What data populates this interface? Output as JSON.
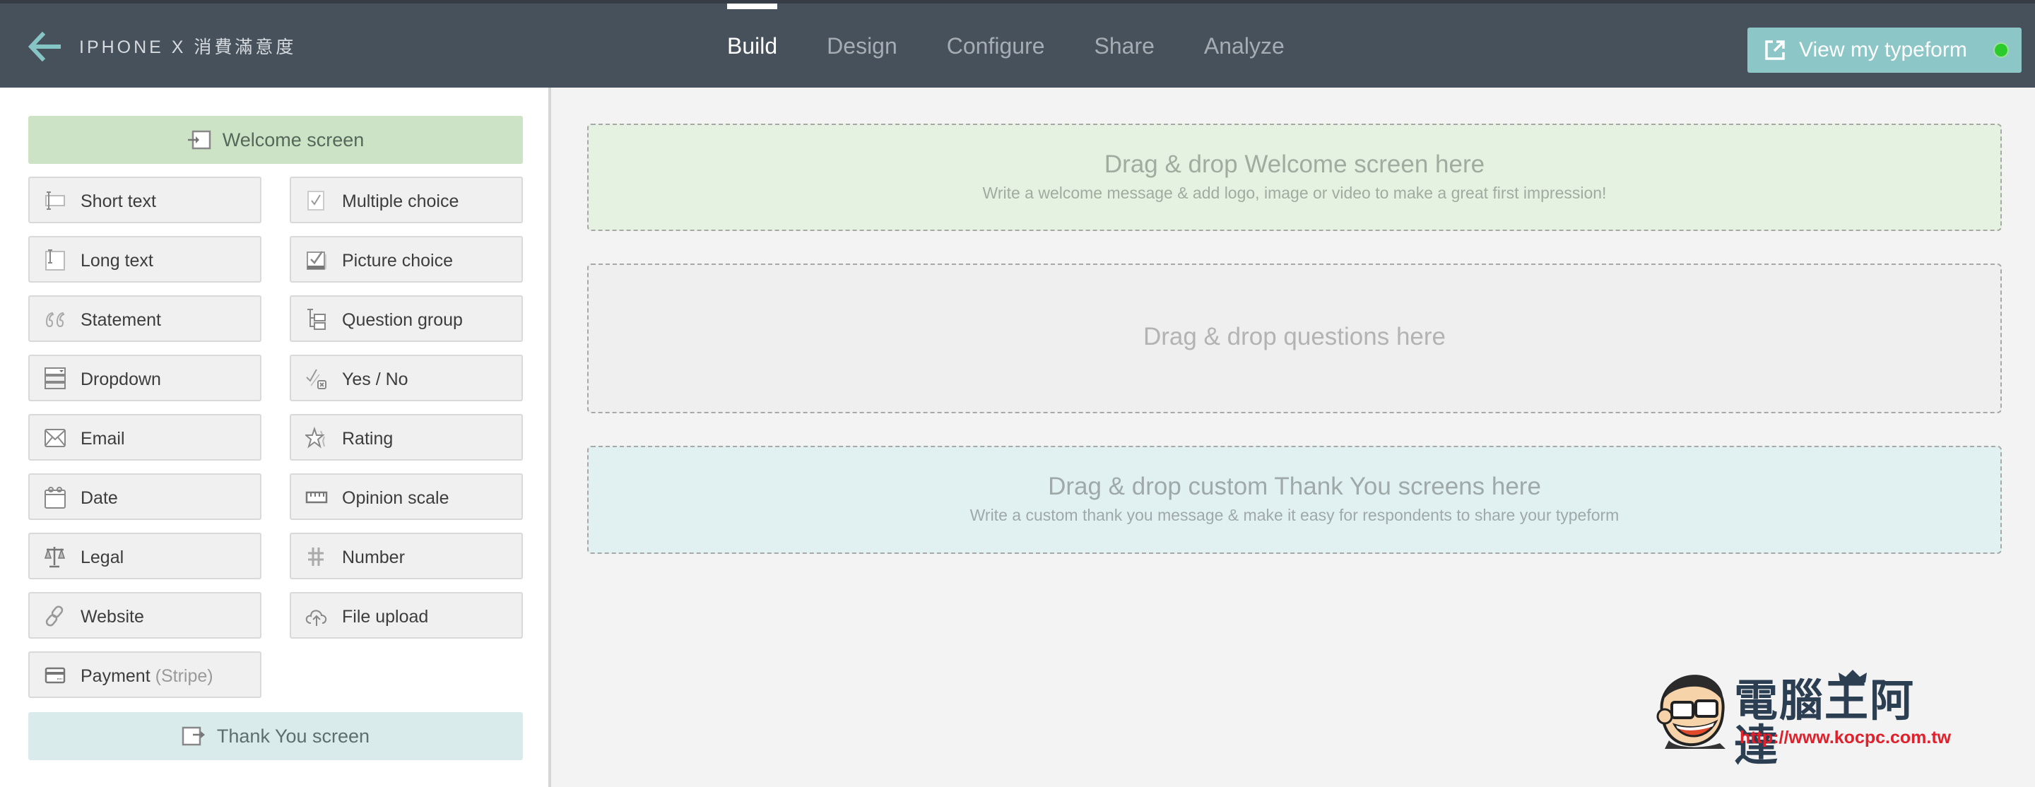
{
  "header": {
    "back_label": "Back",
    "form_title": "IPHONE X 消費滿意度",
    "tabs": [
      {
        "label": "Build",
        "active": true
      },
      {
        "label": "Design",
        "active": false
      },
      {
        "label": "Configure",
        "active": false
      },
      {
        "label": "Share",
        "active": false
      },
      {
        "label": "Analyze",
        "active": false
      }
    ],
    "view_button": {
      "label": "View my typeform",
      "status": "live",
      "status_color": "#2ccb2c"
    }
  },
  "sidebar": {
    "welcome_button": {
      "label": "Welcome screen",
      "icon": "enter-screen-icon"
    },
    "question_types": [
      {
        "label": "Short text",
        "icon": "short-text-icon"
      },
      {
        "label": "Multiple choice",
        "icon": "multiple-choice-icon"
      },
      {
        "label": "Long text",
        "icon": "long-text-icon"
      },
      {
        "label": "Picture choice",
        "icon": "picture-choice-icon"
      },
      {
        "label": "Statement",
        "icon": "quote-icon"
      },
      {
        "label": "Question group",
        "icon": "question-group-icon"
      },
      {
        "label": "Dropdown",
        "icon": "dropdown-icon"
      },
      {
        "label": "Yes / No",
        "icon": "yes-no-icon"
      },
      {
        "label": "Email",
        "icon": "envelope-icon"
      },
      {
        "label": "Rating",
        "icon": "star-icon"
      },
      {
        "label": "Date",
        "icon": "calendar-icon"
      },
      {
        "label": "Opinion scale",
        "icon": "scale-ruler-icon"
      },
      {
        "label": "Legal",
        "icon": "balance-scale-icon"
      },
      {
        "label": "Number",
        "icon": "hash-icon"
      },
      {
        "label": "Website",
        "icon": "link-icon"
      },
      {
        "label": "File upload",
        "icon": "cloud-upload-icon"
      },
      {
        "label": "Payment",
        "sublabel": "(Stripe)",
        "icon": "credit-card-icon"
      }
    ],
    "thanks_button": {
      "label": "Thank You screen",
      "icon": "exit-screen-icon"
    }
  },
  "main": {
    "welcome_zone": {
      "title": "Drag & drop Welcome screen here",
      "subtitle": "Write a welcome message & add logo, image or video to make a great first impression!"
    },
    "questions_zone": {
      "title": "Drag & drop questions here"
    },
    "thanks_zone": {
      "title": "Drag & drop custom Thank You screens here",
      "subtitle": "Write a custom thank you message & make it easy for respondents to share your typeform"
    }
  },
  "watermark": {
    "title": "電腦王阿達",
    "url": "http://www.kocpc.com.tw"
  },
  "colors": {
    "header_bg": "#47515c",
    "accent_teal": "#8cc6c6",
    "welcome_green": "#cde3c6",
    "thanks_teal": "#daebeb"
  }
}
